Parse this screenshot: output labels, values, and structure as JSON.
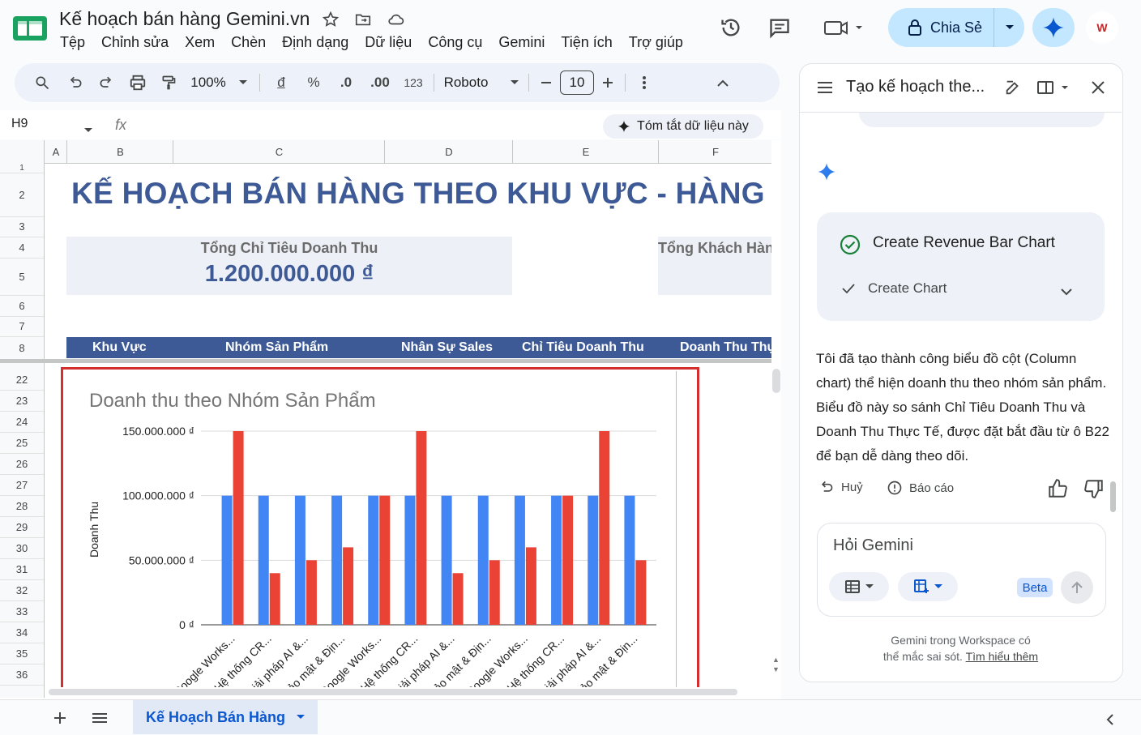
{
  "app": {
    "doc_title": "Kế hoạch bán hàng Gemini.vn",
    "menu": [
      "Tệp",
      "Chỉnh sửa",
      "Xem",
      "Chèn",
      "Định dạng",
      "Dữ liệu",
      "Công cụ",
      "Gemini",
      "Tiện ích",
      "Trợ giúp"
    ],
    "share_label": "Chia Sẻ",
    "brand_color": "#0b57d0"
  },
  "toolbar": {
    "zoom": "100%",
    "currency": "đ",
    "percent": "%",
    "dec_decrease": ".0",
    "dec_increase": ".00",
    "format_123": "123",
    "font": "Roboto",
    "font_size": "10"
  },
  "formula_bar": {
    "cell_ref": "H9",
    "fx": "fx",
    "summarize_chip": "Tóm tắt dữ liệu này"
  },
  "grid": {
    "columns": [
      "A",
      "B",
      "C",
      "D",
      "E",
      "F"
    ],
    "rows_top": [
      "1",
      "2",
      "3",
      "4",
      "5",
      "6",
      "7",
      "8"
    ],
    "rows_bottom": [
      "22",
      "23",
      "24",
      "25",
      "26",
      "27",
      "28",
      "29",
      "30",
      "31",
      "32",
      "33",
      "34",
      "35",
      "36"
    ],
    "title": "KẾ HOẠCH BÁN HÀNG THEO KHU VỰC - HÀNG",
    "card_total_label": "Tổng Chỉ Tiêu Doanh Thu",
    "card_total_value": "1.200.000.000 ₫",
    "card_customers_label": "Tổng Khách Hàng",
    "table_headers": [
      "Khu Vực",
      "Nhóm Sản Phẩm",
      "Nhân Sự Sales",
      "Chỉ Tiêu Doanh Thu",
      "Doanh Thu Thực Tế"
    ],
    "header_color": "#3d5a96"
  },
  "chart_data": {
    "type": "bar",
    "title": "Doanh thu theo Nhóm Sản Phẩm",
    "ylabel": "Doanh Thu",
    "xlabel": "",
    "ylim": [
      0,
      150000000
    ],
    "y_ticks": [
      "0 ₫",
      "50.000.000 ₫",
      "100.000.000 ₫",
      "150.000.000 ₫"
    ],
    "categories": [
      "Google Works...",
      "Hệ thống CR...",
      "Giải pháp AI &...",
      "Bảo mật & Địn...",
      "Google Works...",
      "Hệ thống CR...",
      "Giải pháp AI &...",
      "Bảo mật & Địn...",
      "Google Works...",
      "Hệ thống CR...",
      "Giải pháp AI &...",
      "Bảo mật & Địn..."
    ],
    "series": [
      {
        "values": [
          100000000,
          100000000,
          100000000,
          100000000,
          100000000,
          100000000,
          100000000,
          100000000,
          100000000,
          100000000,
          100000000,
          100000000
        ],
        "color": "#4285f4"
      },
      {
        "values": [
          150000000,
          40000000,
          50000000,
          60000000,
          100000000,
          150000000,
          40000000,
          50000000,
          60000000,
          100000000,
          150000000,
          50000000
        ],
        "color": "#ea4335"
      }
    ],
    "grid": true
  },
  "sheet_tab": "Kế Hoạch Bán Hàng",
  "panel": {
    "title": "Tạo kế hoạch the...",
    "action_title": "Create Revenue Bar Chart",
    "action_step": "Create Chart",
    "response": "Tôi đã tạo thành công biểu đồ cột (Column chart) thể hiện doanh thu theo nhóm sản phẩm. Biểu đồ này so sánh Chỉ Tiêu Doanh Thu và Doanh Thu Thực Tế, được đặt bắt đầu từ ô B22 để bạn dễ dàng theo dõi.",
    "undo": "Huỷ",
    "report": "Báo cáo",
    "ask_placeholder": "Hỏi Gemini",
    "beta": "Beta",
    "disclaimer_line1": "Gemini trong Workspace có",
    "disclaimer_line2": "thể mắc sai sót.",
    "learn_more": "Tìm hiểu thêm",
    "avatar_text": "W"
  }
}
